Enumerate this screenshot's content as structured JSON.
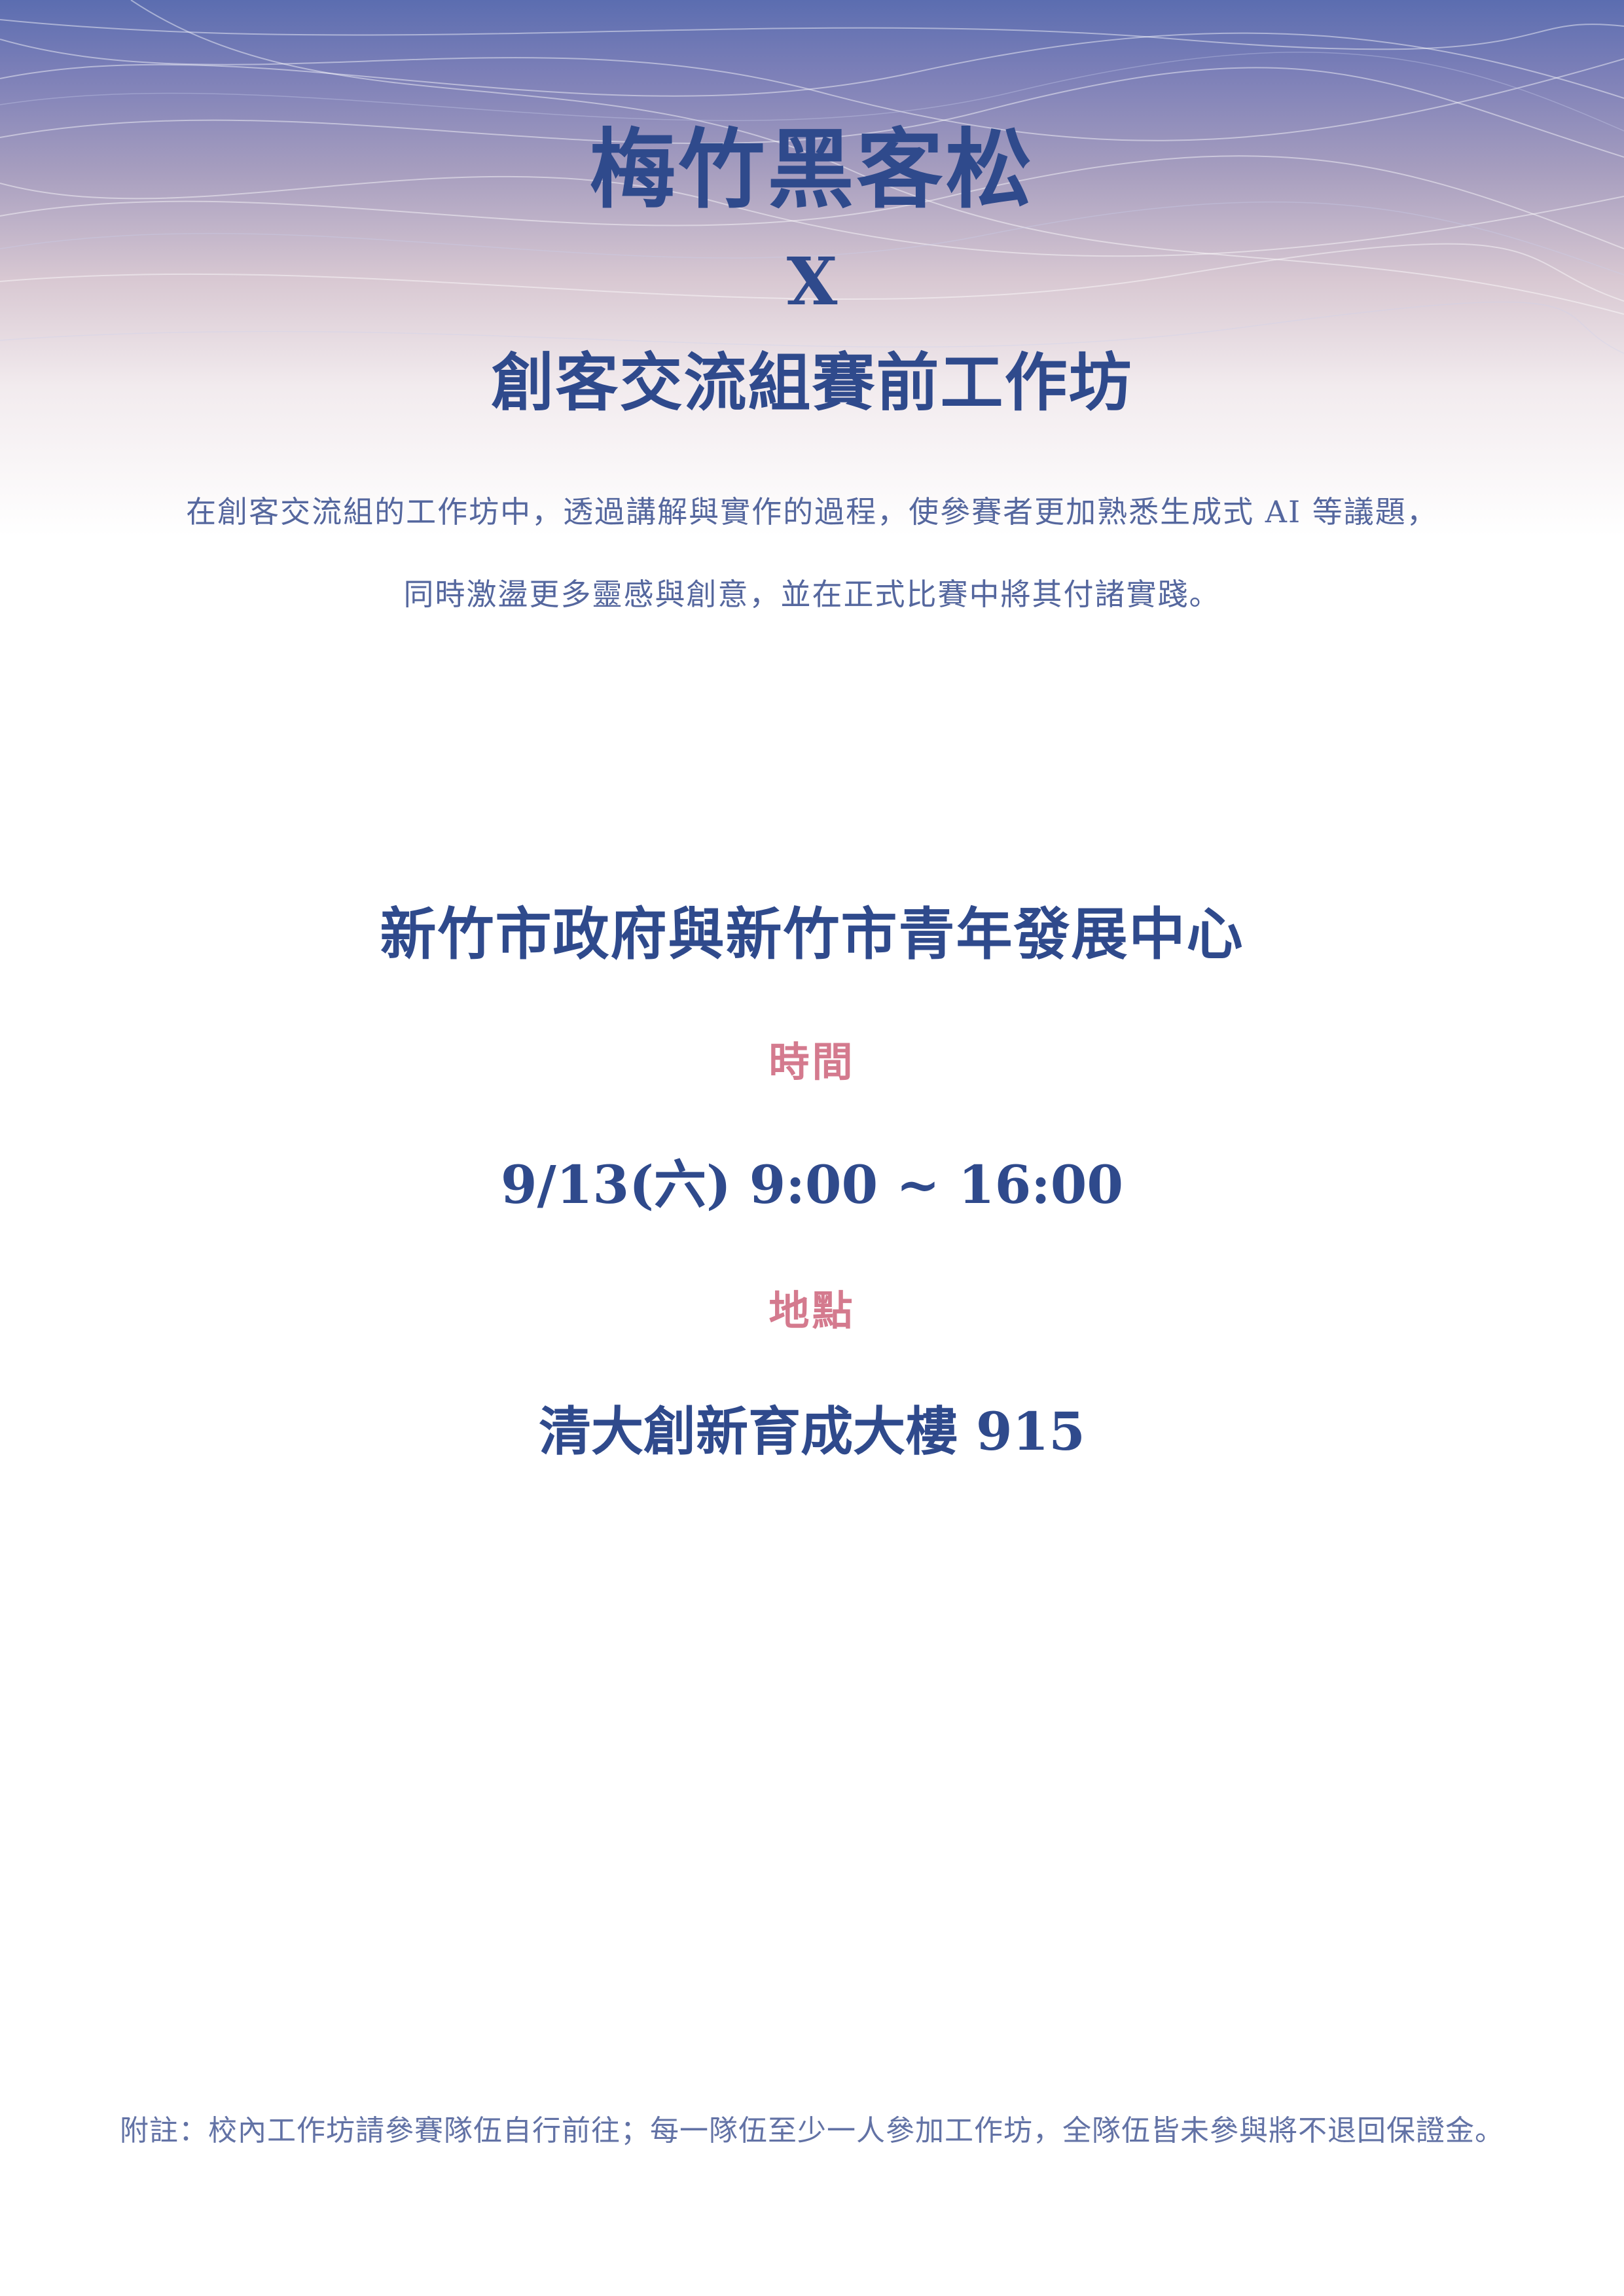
{
  "header": {
    "title": "梅竹黑客松",
    "connector": "X",
    "subtitle": "創客交流組賽前工作坊"
  },
  "description": {
    "line1": "在創客交流組的工作坊中，透過講解與實作的過程，使參賽者更加熟悉生成式 AI 等議題，",
    "line2": "同時激盪更多靈感與創意，並在正式比賽中將其付諸實踐。"
  },
  "organizer": "新竹市政府與新竹市青年發展中心",
  "details": {
    "time_label": "時間",
    "time_value": "9/13(六) 9:00 ~ 16:00",
    "place_label": "地點",
    "place_value": "清大創新育成大樓 915"
  },
  "footer": {
    "note": "附註：校內工作坊請參賽隊伍自行前往；每一隊伍至少一人參加工作坊，全隊伍皆未參與將不退回保證金。"
  },
  "colors": {
    "primary_text": "#2f4a8c",
    "accent_label": "#d47a8e",
    "header_gradient_top": "#5b6db0",
    "header_gradient_bottom": "#ffffff"
  }
}
